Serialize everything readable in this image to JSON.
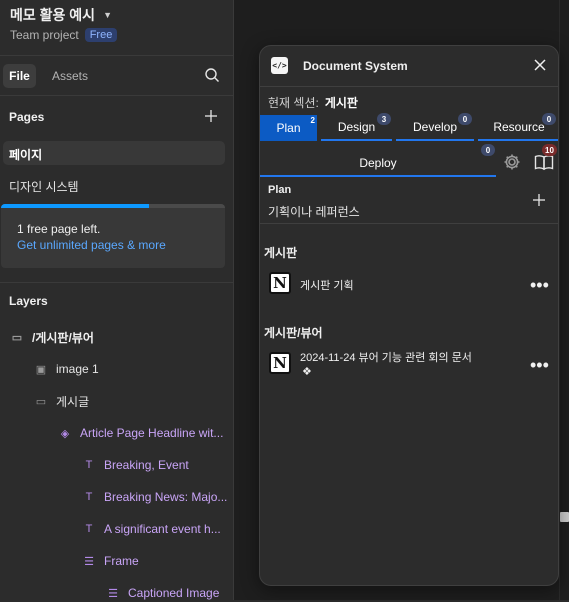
{
  "file": {
    "title": "메모 활용 예시",
    "team": "Team project",
    "plan_badge": "Free"
  },
  "tabs": {
    "file": "File",
    "assets": "Assets"
  },
  "pages": {
    "label": "Pages",
    "items": [
      "페이지",
      "디자인 시스템"
    ]
  },
  "upsell": {
    "line1": "1 free page left.",
    "line2": "Get unlimited pages & more",
    "progress": 0.66
  },
  "layers": {
    "label": "Layers",
    "items": [
      {
        "name": "/게시판/뷰어"
      },
      {
        "name": "image 1"
      },
      {
        "name": "게시글"
      },
      {
        "name": "Article Page Headline wit..."
      },
      {
        "name": "Breaking, Event"
      },
      {
        "name": "Breaking News: Majo..."
      },
      {
        "name": "A significant event h..."
      },
      {
        "name": "Frame"
      },
      {
        "name": "Captioned Image"
      }
    ]
  },
  "panel": {
    "logo": "</>",
    "title": "Document System",
    "section_label": "현재 섹션:",
    "section_value": "게시판",
    "tabs": [
      {
        "label": "Plan",
        "count": "2"
      },
      {
        "label": "Design",
        "count": "3"
      },
      {
        "label": "Develop",
        "count": "0"
      },
      {
        "label": "Resource",
        "count": "0"
      }
    ],
    "deploy": {
      "label": "Deploy",
      "count": "0"
    },
    "book_count": "10",
    "plan": {
      "title": "Plan",
      "desc": "기획이나 레퍼런스"
    },
    "groups": [
      {
        "title": "게시판",
        "items": [
          {
            "label": "게시판 기획"
          }
        ]
      },
      {
        "title": "게시판/뷰어",
        "items": [
          {
            "label": "2024-11-24 뷰어 기능 관련 회의 문서",
            "sub": "❖"
          }
        ]
      }
    ]
  },
  "colors": {
    "accent": "#0c5bc4",
    "link": "#5aa8ff",
    "layer_purple": "#c9a5f7"
  }
}
